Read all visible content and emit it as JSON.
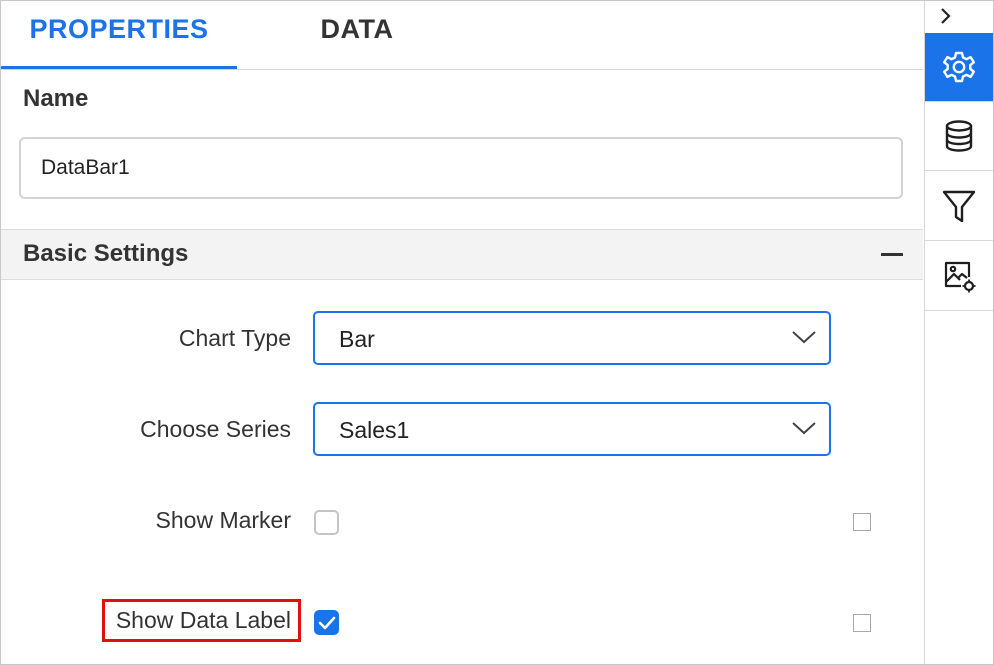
{
  "tabs": [
    {
      "label": "PROPERTIES",
      "active": true
    },
    {
      "label": "DATA",
      "active": false
    }
  ],
  "name_section": {
    "label": "Name",
    "value": "DataBar1"
  },
  "basic_settings": {
    "title": "Basic Settings",
    "collapse_icon": "minus-icon",
    "chart_type": {
      "label": "Chart Type",
      "value": "Bar"
    },
    "choose_series": {
      "label": "Choose Series",
      "value": "Sales1"
    },
    "show_marker": {
      "label": "Show Marker",
      "checked": false
    },
    "show_data_label": {
      "label": "Show Data Label",
      "checked": true,
      "highlighted": true
    }
  },
  "rail": {
    "toggle_icon": "chevron-right-icon",
    "items": [
      {
        "icon": "gear-icon",
        "active": true
      },
      {
        "icon": "database-icon",
        "active": false
      },
      {
        "icon": "filter-icon",
        "active": false
      },
      {
        "icon": "image-settings-icon",
        "active": false
      }
    ]
  },
  "colors": {
    "accent": "#1a73e8",
    "highlight": "#e01010",
    "text": "#333333",
    "header_bg": "#f3f3f3"
  }
}
